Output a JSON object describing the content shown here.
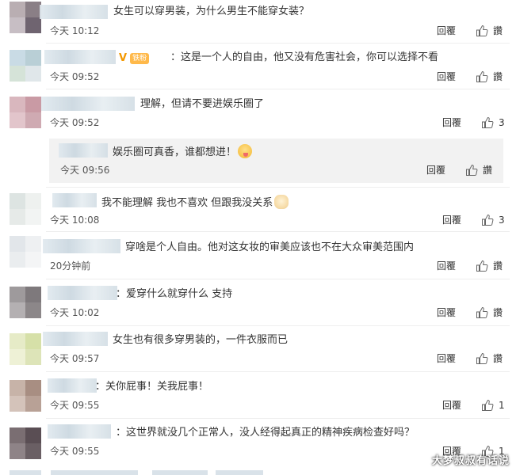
{
  "actions": {
    "reply_label": "回覆",
    "like_label": "讚"
  },
  "comments": [
    {
      "text": "女生可以穿男装，为什么男生不能穿女装？",
      "time": "今天 10:12",
      "likes": "讚"
    },
    {
      "text": "：这是一个人的自由，他又没有危害社会，你可以选择不看",
      "time": "今天 09:52",
      "likes": "讚",
      "badge": "铁粉"
    },
    {
      "text": "理解，但请不要进娱乐圈了",
      "time": "今天 09:52",
      "likes": "3",
      "reply": {
        "text": "娱乐圈可真香，谁都想进！",
        "time": "今天 09:56",
        "likes": "讚"
      }
    },
    {
      "text": "我不能理解 我也不喜欢 但跟我没关系",
      "time": "今天 10:08",
      "likes": "3"
    },
    {
      "text": "穿啥是个人自由。他对这女妆的审美应该也不在大众审美范围内",
      "time": "20分钟前",
      "likes": "讚"
    },
    {
      "text": "：爱穿什么就穿什么 支持",
      "time": "今天 10:02",
      "likes": "讚"
    },
    {
      "text": "女生也有很多穿男装的，一件衣服而已",
      "time": "今天 09:57",
      "likes": "讚"
    },
    {
      "text": "：关你屁事！关我屁事！",
      "time": "今天 09:55",
      "likes": "1"
    },
    {
      "text": "：这世界就没几个正常人，没人经得起真正的精神疾病检查好吗？",
      "time": "今天 09:55",
      "likes": "1"
    }
  ],
  "watermark": "大梦叔叔有话说",
  "colors": {
    "background": "#ffffff",
    "reply_box": "#f2f2f2",
    "badge": "#ffb94a",
    "vip": "#f39800"
  }
}
